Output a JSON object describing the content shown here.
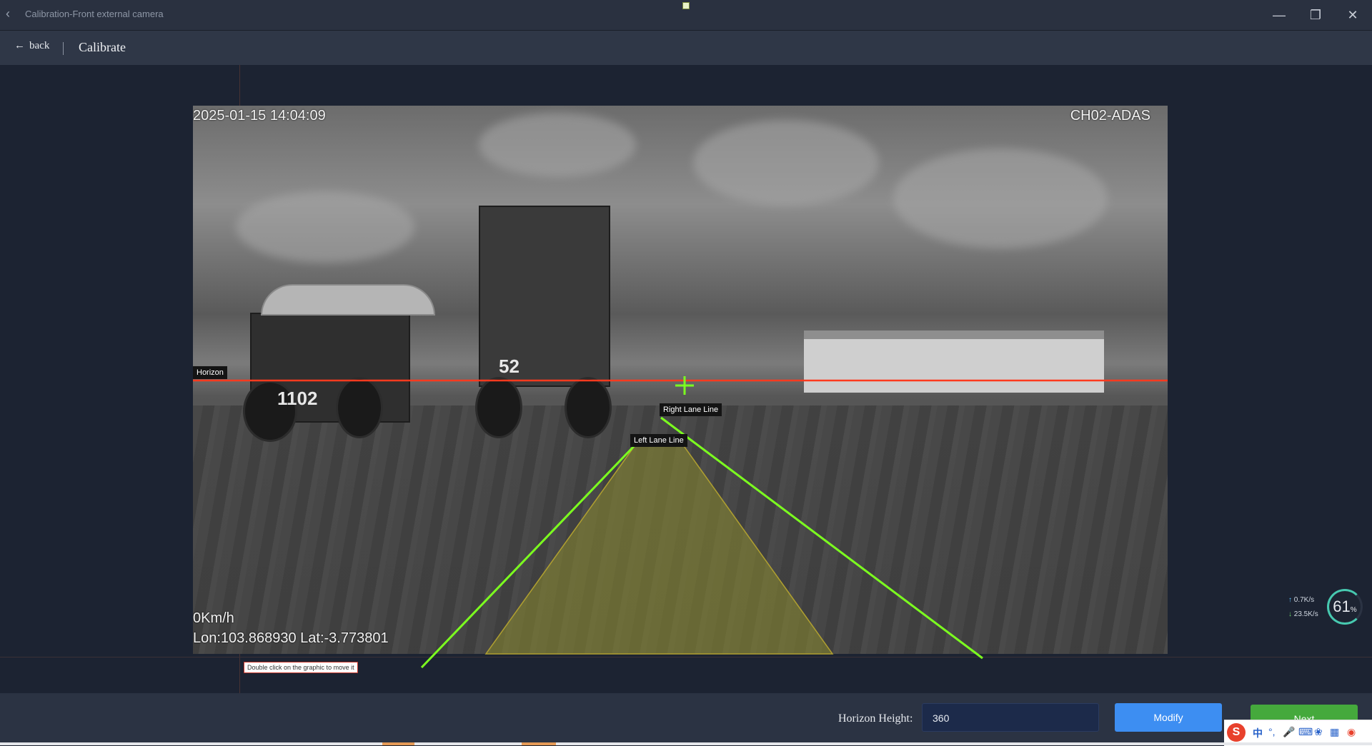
{
  "window": {
    "title": "Calibration-Front external camera",
    "back_icon": "chevron-left-icon",
    "controls": [
      "minimize-icon",
      "restore-icon",
      "close-icon"
    ]
  },
  "toolbar": {
    "back_label": "back",
    "title": "Calibrate"
  },
  "camera": {
    "timestamp": "2025-01-15 14:04:09",
    "channel": "CH02-ADAS",
    "speed": "0Km/h",
    "location": "Lon:103.868930 Lat:-3.773801",
    "truck_left_number": "1102",
    "truck_center_number": "52"
  },
  "overlay": {
    "horizon_label": "Horizon",
    "right_lane_label": "Right Lane Line",
    "left_lane_label": "Left Lane Line",
    "hint": "Double click on the graphic to move it",
    "colors": {
      "horizon": "#ff3a1e",
      "lane": "#7cff1f",
      "zone_fill": "#8a8a2e"
    }
  },
  "bottom": {
    "horizon_height_label": "Horizon Height:",
    "horizon_height_value": "360",
    "modify_label": "Modify",
    "next_label": "Next"
  },
  "net_widget": {
    "upload": "0.7K/s",
    "download": "23.5K/s",
    "percent": "61",
    "percent_unit": "%"
  },
  "tray": {
    "ime_char": "中"
  }
}
